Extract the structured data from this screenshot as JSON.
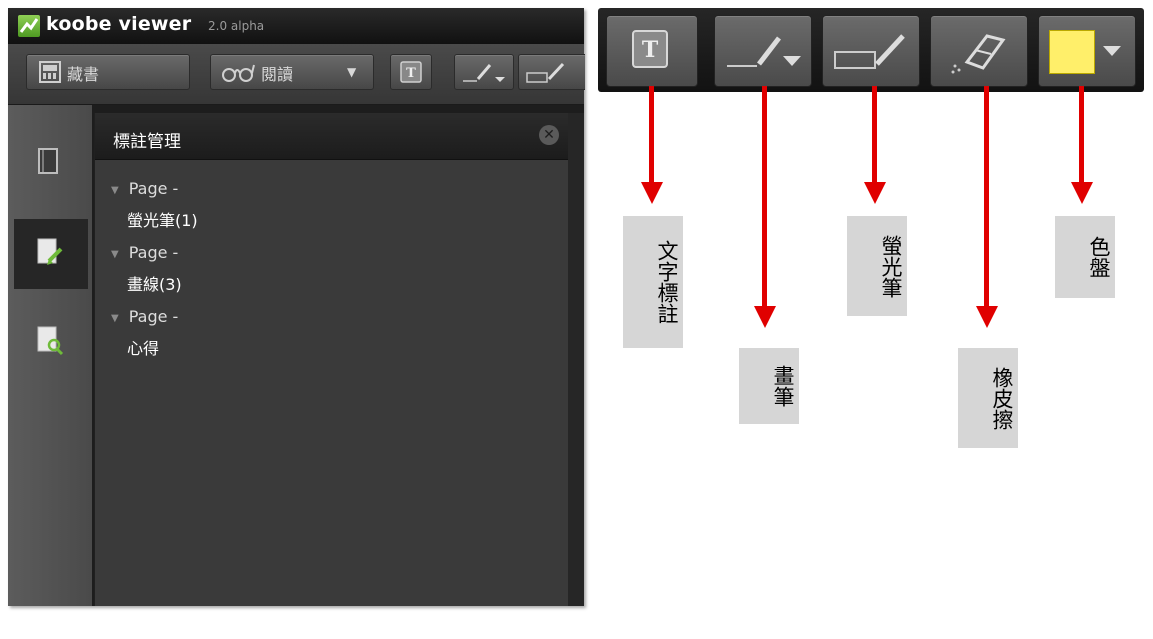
{
  "app": {
    "name": "koobe viewer",
    "version": "2.0 alpha"
  },
  "toolbar": {
    "bookcase_label": "藏書",
    "reading_label": "閱讀",
    "reading_dropdown_arrow": "▼"
  },
  "panel": {
    "title": "標註管理",
    "close_symbol": "✕",
    "items": [
      {
        "page": "Page -",
        "child": "螢光筆(1)"
      },
      {
        "page": "Page -",
        "child": "畫線(3)"
      },
      {
        "page": "Page -",
        "child": "心得"
      }
    ]
  },
  "legend": {
    "text_note": "文字標註",
    "pen": "畫筆",
    "highlighter": "螢光筆",
    "eraser": "橡皮擦",
    "palette": "色盤"
  },
  "colors": {
    "accent_red": "#e00000",
    "palette_yellow": "#ffef6a",
    "logo_green": "#6fbb3a"
  },
  "icons": {
    "sidebar": [
      "book-page-icon",
      "annotation-edit-icon",
      "search-page-icon"
    ],
    "toolbar": [
      "text-note-icon",
      "pen-icon",
      "highlighter-icon",
      "eraser-icon",
      "color-palette-icon"
    ]
  }
}
